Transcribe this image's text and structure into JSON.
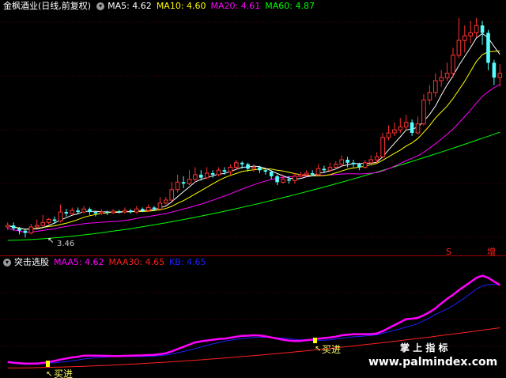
{
  "main_panel": {
    "title": "金枫酒业(日线,前复权)",
    "ma": [
      {
        "label": "MA5: 4.62",
        "color": "#ffffff"
      },
      {
        "label": "MA10: 4.60",
        "color": "#ffff00"
      },
      {
        "label": "MA20: 4.61",
        "color": "#ff00ff"
      },
      {
        "label": "MA60: 4.87",
        "color": "#00ff00"
      }
    ],
    "low_marker": "3.46",
    "signals": [
      {
        "text": "S",
        "color": "#ff2020"
      },
      {
        "text": "增",
        "color": "#ff2020"
      }
    ]
  },
  "sub_panel": {
    "title": "突击选股",
    "indicators": [
      {
        "label": "MAA5: 4.62",
        "color": "#ff00ff"
      },
      {
        "label": "MAA30: 4.65",
        "color": "#ff2020"
      },
      {
        "label": "KB: 4.65",
        "color": "#2020ff"
      }
    ],
    "buy_label": "买进"
  },
  "watermark": {
    "line1": "掌 上 指 标",
    "line2": "www.palmindex.com"
  },
  "chart_data": {
    "type": "candlestick",
    "title": "金枫酒业(日线,前复权)",
    "low_price": 3.46,
    "last_values": {
      "MA5": 4.62,
      "MA10": 4.6,
      "MA20": 4.61,
      "MA60": 4.87,
      "MAA5": 4.62,
      "MAA30": 4.65,
      "KB": 4.65
    },
    "candles": [
      [
        3.6,
        3.62,
        3.66,
        3.56
      ],
      [
        3.62,
        3.58,
        3.66,
        3.55
      ],
      [
        3.58,
        3.55,
        3.6,
        3.5
      ],
      [
        3.55,
        3.52,
        3.58,
        3.46
      ],
      [
        3.52,
        3.6,
        3.64,
        3.5
      ],
      [
        3.6,
        3.62,
        3.7,
        3.58
      ],
      [
        3.62,
        3.66,
        3.76,
        3.6
      ],
      [
        3.66,
        3.7,
        3.72,
        3.64
      ],
      [
        3.7,
        3.68,
        3.74,
        3.64
      ],
      [
        3.68,
        3.8,
        3.9,
        3.66
      ],
      [
        3.8,
        3.78,
        3.84,
        3.74
      ],
      [
        3.78,
        3.82,
        3.86,
        3.76
      ],
      [
        3.82,
        3.8,
        3.86,
        3.78
      ],
      [
        3.8,
        3.84,
        3.88,
        3.78
      ],
      [
        3.84,
        3.8,
        3.86,
        3.76
      ],
      [
        3.8,
        3.78,
        3.82,
        3.74
      ],
      [
        3.78,
        3.8,
        3.84,
        3.76
      ],
      [
        3.8,
        3.79,
        3.82,
        3.76
      ],
      [
        3.79,
        3.81,
        3.84,
        3.77
      ],
      [
        3.81,
        3.8,
        3.83,
        3.78
      ],
      [
        3.8,
        3.82,
        3.86,
        3.78
      ],
      [
        3.82,
        3.8,
        3.84,
        3.78
      ],
      [
        3.8,
        3.84,
        3.88,
        3.78
      ],
      [
        3.84,
        3.82,
        3.86,
        3.8
      ],
      [
        3.82,
        3.86,
        3.9,
        3.8
      ],
      [
        3.86,
        3.84,
        3.88,
        3.82
      ],
      [
        3.84,
        3.92,
        4.0,
        3.84
      ],
      [
        3.92,
        3.96,
        4.0,
        3.9
      ],
      [
        3.96,
        4.1,
        4.2,
        3.94
      ],
      [
        4.1,
        4.2,
        4.3,
        4.06
      ],
      [
        4.2,
        4.18,
        4.28,
        4.12
      ],
      [
        4.18,
        4.24,
        4.36,
        4.16
      ],
      [
        4.24,
        4.3,
        4.4,
        4.2
      ],
      [
        4.3,
        4.26,
        4.36,
        4.22
      ],
      [
        4.26,
        4.32,
        4.4,
        4.24
      ],
      [
        4.32,
        4.3,
        4.36,
        4.26
      ],
      [
        4.3,
        4.36,
        4.4,
        4.28
      ],
      [
        4.36,
        4.34,
        4.4,
        4.3
      ],
      [
        4.34,
        4.4,
        4.44,
        4.3
      ],
      [
        4.4,
        4.46,
        4.5,
        4.36
      ],
      [
        4.46,
        4.44,
        4.48,
        4.38
      ],
      [
        4.44,
        4.38,
        4.46,
        4.34
      ],
      [
        4.38,
        4.4,
        4.44,
        4.34
      ],
      [
        4.4,
        4.36,
        4.42,
        4.32
      ],
      [
        4.36,
        4.34,
        4.38,
        4.3
      ],
      [
        4.34,
        4.28,
        4.36,
        4.24
      ],
      [
        4.28,
        4.2,
        4.3,
        4.16
      ],
      [
        4.2,
        4.24,
        4.3,
        4.18
      ],
      [
        4.24,
        4.22,
        4.28,
        4.18
      ],
      [
        4.22,
        4.28,
        4.32,
        4.18
      ],
      [
        4.28,
        4.3,
        4.34,
        4.26
      ],
      [
        4.3,
        4.32,
        4.36,
        4.28
      ],
      [
        4.32,
        4.3,
        4.36,
        4.28
      ],
      [
        4.3,
        4.38,
        4.44,
        4.3
      ],
      [
        4.38,
        4.36,
        4.42,
        4.32
      ],
      [
        4.36,
        4.4,
        4.46,
        4.34
      ],
      [
        4.4,
        4.44,
        4.48,
        4.38
      ],
      [
        4.44,
        4.5,
        4.56,
        4.4
      ],
      [
        4.5,
        4.46,
        4.54,
        4.4
      ],
      [
        4.46,
        4.44,
        4.5,
        4.4
      ],
      [
        4.44,
        4.4,
        4.46,
        4.36
      ],
      [
        4.4,
        4.46,
        4.5,
        4.38
      ],
      [
        4.46,
        4.5,
        4.56,
        4.44
      ],
      [
        4.5,
        4.54,
        4.6,
        4.46
      ],
      [
        4.54,
        4.8,
        4.86,
        4.52
      ],
      [
        4.8,
        4.86,
        4.96,
        4.76
      ],
      [
        4.86,
        4.9,
        5.0,
        4.82
      ],
      [
        4.9,
        4.94,
        5.06,
        4.86
      ],
      [
        4.94,
        5.0,
        5.1,
        4.9
      ],
      [
        5.0,
        4.86,
        5.04,
        4.82
      ],
      [
        4.86,
        4.98,
        5.08,
        4.84
      ],
      [
        4.98,
        5.3,
        5.38,
        4.96
      ],
      [
        5.3,
        5.4,
        5.5,
        5.24
      ],
      [
        5.4,
        5.56,
        5.66,
        5.34
      ],
      [
        5.56,
        5.6,
        5.7,
        5.48
      ],
      [
        5.6,
        5.66,
        5.8,
        5.56
      ],
      [
        5.66,
        5.9,
        6.0,
        5.6
      ],
      [
        5.9,
        6.1,
        6.4,
        5.86
      ],
      [
        6.1,
        6.16,
        6.3,
        5.94
      ],
      [
        6.16,
        6.2,
        6.36,
        6.06
      ],
      [
        6.2,
        6.3,
        6.4,
        6.14
      ],
      [
        6.3,
        6.2,
        6.36,
        6.04
      ],
      [
        6.2,
        5.8,
        6.24,
        5.7
      ],
      [
        5.8,
        5.6,
        5.84,
        5.5
      ],
      [
        5.6,
        5.66,
        5.78,
        5.48
      ]
    ]
  }
}
